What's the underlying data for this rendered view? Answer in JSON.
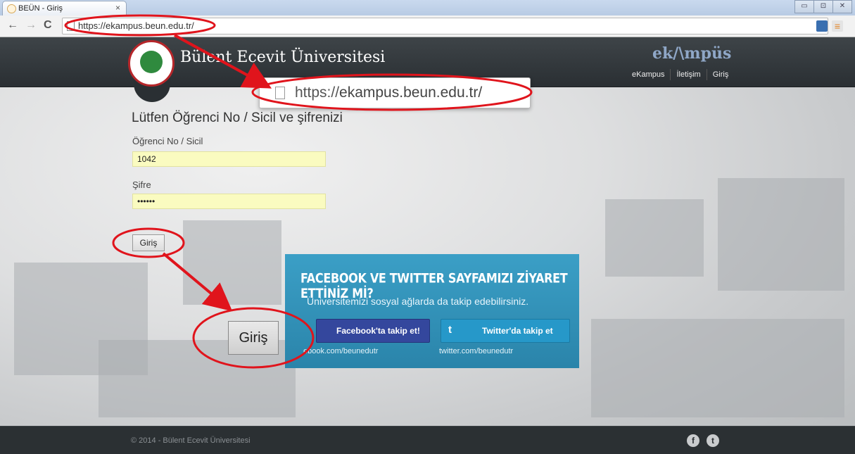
{
  "browser": {
    "tab_title": "BEÜN - Giriş",
    "tab_close": "×",
    "url": "https://ekampus.beun.edu.tr/",
    "nav": {
      "back": "←",
      "forward": "→",
      "reload": "C"
    },
    "window_buttons": [
      "▭",
      "⊡",
      "✕"
    ]
  },
  "site": {
    "brand_name": "Bülent Ecevit Üniversitesi",
    "ekampus_logo": "ek/\\mpüs",
    "top_nav": [
      "eKampus",
      "İletişim",
      "Giriş"
    ],
    "zoom_url": {
      "proto": "https://",
      "host": "ekampus.beun.edu.tr",
      "trail": "/"
    },
    "login": {
      "title": "Lütfen Öğrenci No / Sicil ve şifrenizi",
      "student_label": "Öğrenci No / Sicil",
      "student_value": "1042",
      "password_label": "Şifre",
      "password_value": "••••••",
      "submit_label": "Giriş",
      "submit_label_zoomed": "Giriş"
    },
    "social": {
      "heading": "FACEBOOK VE TWITTER SAYFAMIZI ZİYARET ETTİNİZ Mİ?",
      "subheading": "Üniversitemizi sosyal ağlarda da takip edebilirsiniz.",
      "facebook_button": "Facebook'ta takip et!",
      "twitter_button": "Twitter'da takip et",
      "twitter_glyph": "t",
      "facebook_link": "ebook.com/beunedutr",
      "twitter_link": "twitter.com/beunedutr"
    },
    "footer": {
      "copyright": "© 2014 - Bülent Ecevit Üniversitesi",
      "icons": [
        "f",
        "t"
      ]
    }
  },
  "colors": {
    "annotation_red": "#e0141c",
    "header_dark": "#2a2f33",
    "social_blue": "#2a84aa",
    "facebook_blue": "#34479d",
    "input_yellow": "#fafbc0"
  }
}
